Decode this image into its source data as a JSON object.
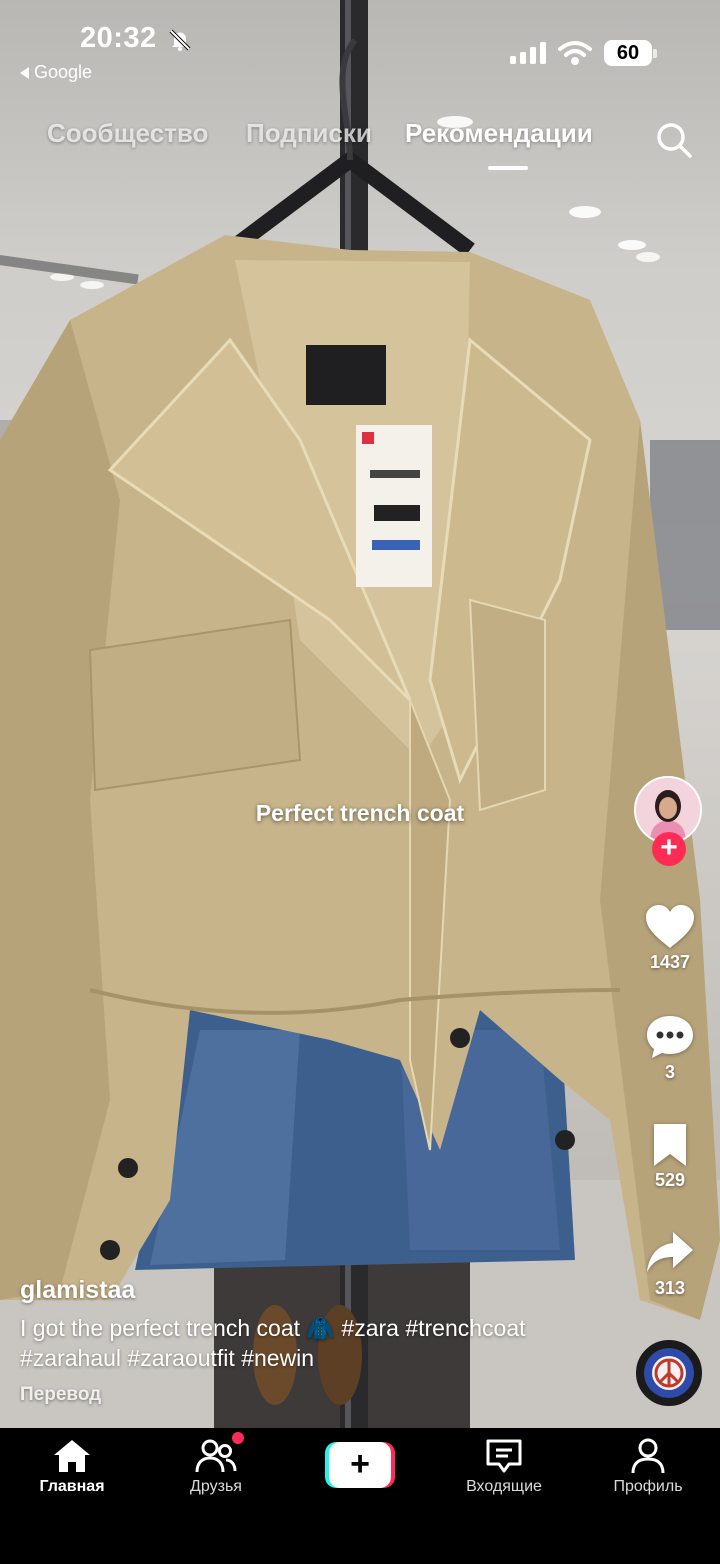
{
  "status_bar": {
    "time": "20:32",
    "back_app": "Google",
    "battery": "60"
  },
  "feed_tabs": [
    {
      "label": "Сообщество",
      "active": false
    },
    {
      "label": "Подписки",
      "active": false
    },
    {
      "label": "Рекомендации",
      "active": true
    }
  ],
  "video": {
    "overlay_text": "Perfect trench coat"
  },
  "actions": {
    "likes": "1437",
    "comments": "3",
    "saves": "529",
    "shares": "313"
  },
  "post": {
    "author": "glamistaa",
    "description": "I got the perfect trench coat 🧥 #zara #trenchcoat #zarahaul #zaraoutfit #newin",
    "translate": "Перевод"
  },
  "bottom_nav": {
    "home": "Главная",
    "friends": "Друзья",
    "create": "+",
    "inbox": "Входящие",
    "profile": "Профиль"
  },
  "colors": {
    "accent": "#fe2c55",
    "cyan": "#25f4ee",
    "coat": "#c9b78c"
  }
}
